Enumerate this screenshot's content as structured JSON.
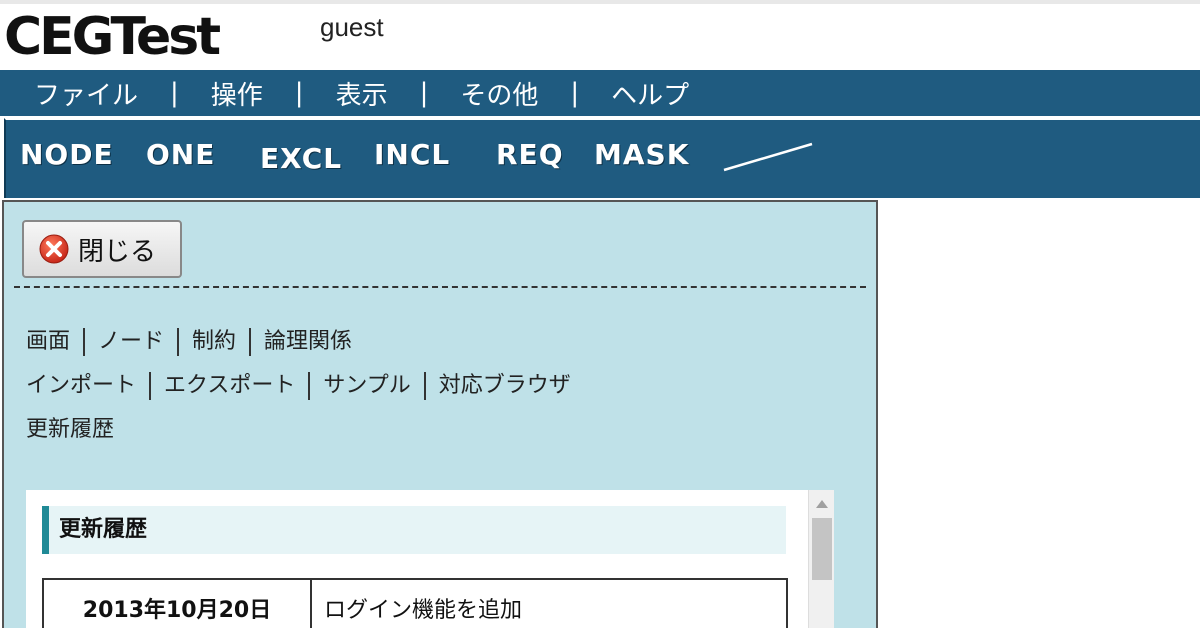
{
  "app": {
    "logo": "CEGTest",
    "user": "guest"
  },
  "menu": {
    "items": [
      "ファイル",
      "操作",
      "表示",
      "その他",
      "ヘルプ"
    ],
    "separator": "|"
  },
  "toolbar": {
    "tools": [
      "NODE",
      "ONE",
      "EXCL",
      "INCL",
      "REQ",
      "MASK"
    ],
    "line_tool_icon": "line-icon"
  },
  "panel": {
    "close_label": "閉じる",
    "close_icon": "close-circle-icon",
    "links_row1": [
      "画面",
      "ノード",
      "制約",
      "論理関係"
    ],
    "links_row2": [
      "インポート",
      "エクスポート",
      "サンプル",
      "対応ブラウザ"
    ],
    "links_row3": [
      "更新履歴"
    ],
    "section_title": "更新履歴",
    "history": [
      {
        "date": "2013年10月20日",
        "text": "ログイン機能を追加"
      }
    ]
  },
  "colors": {
    "menubar_bg": "#1f5b80",
    "panel_bg": "#bfe1e8",
    "accent": "#1f8a96"
  }
}
